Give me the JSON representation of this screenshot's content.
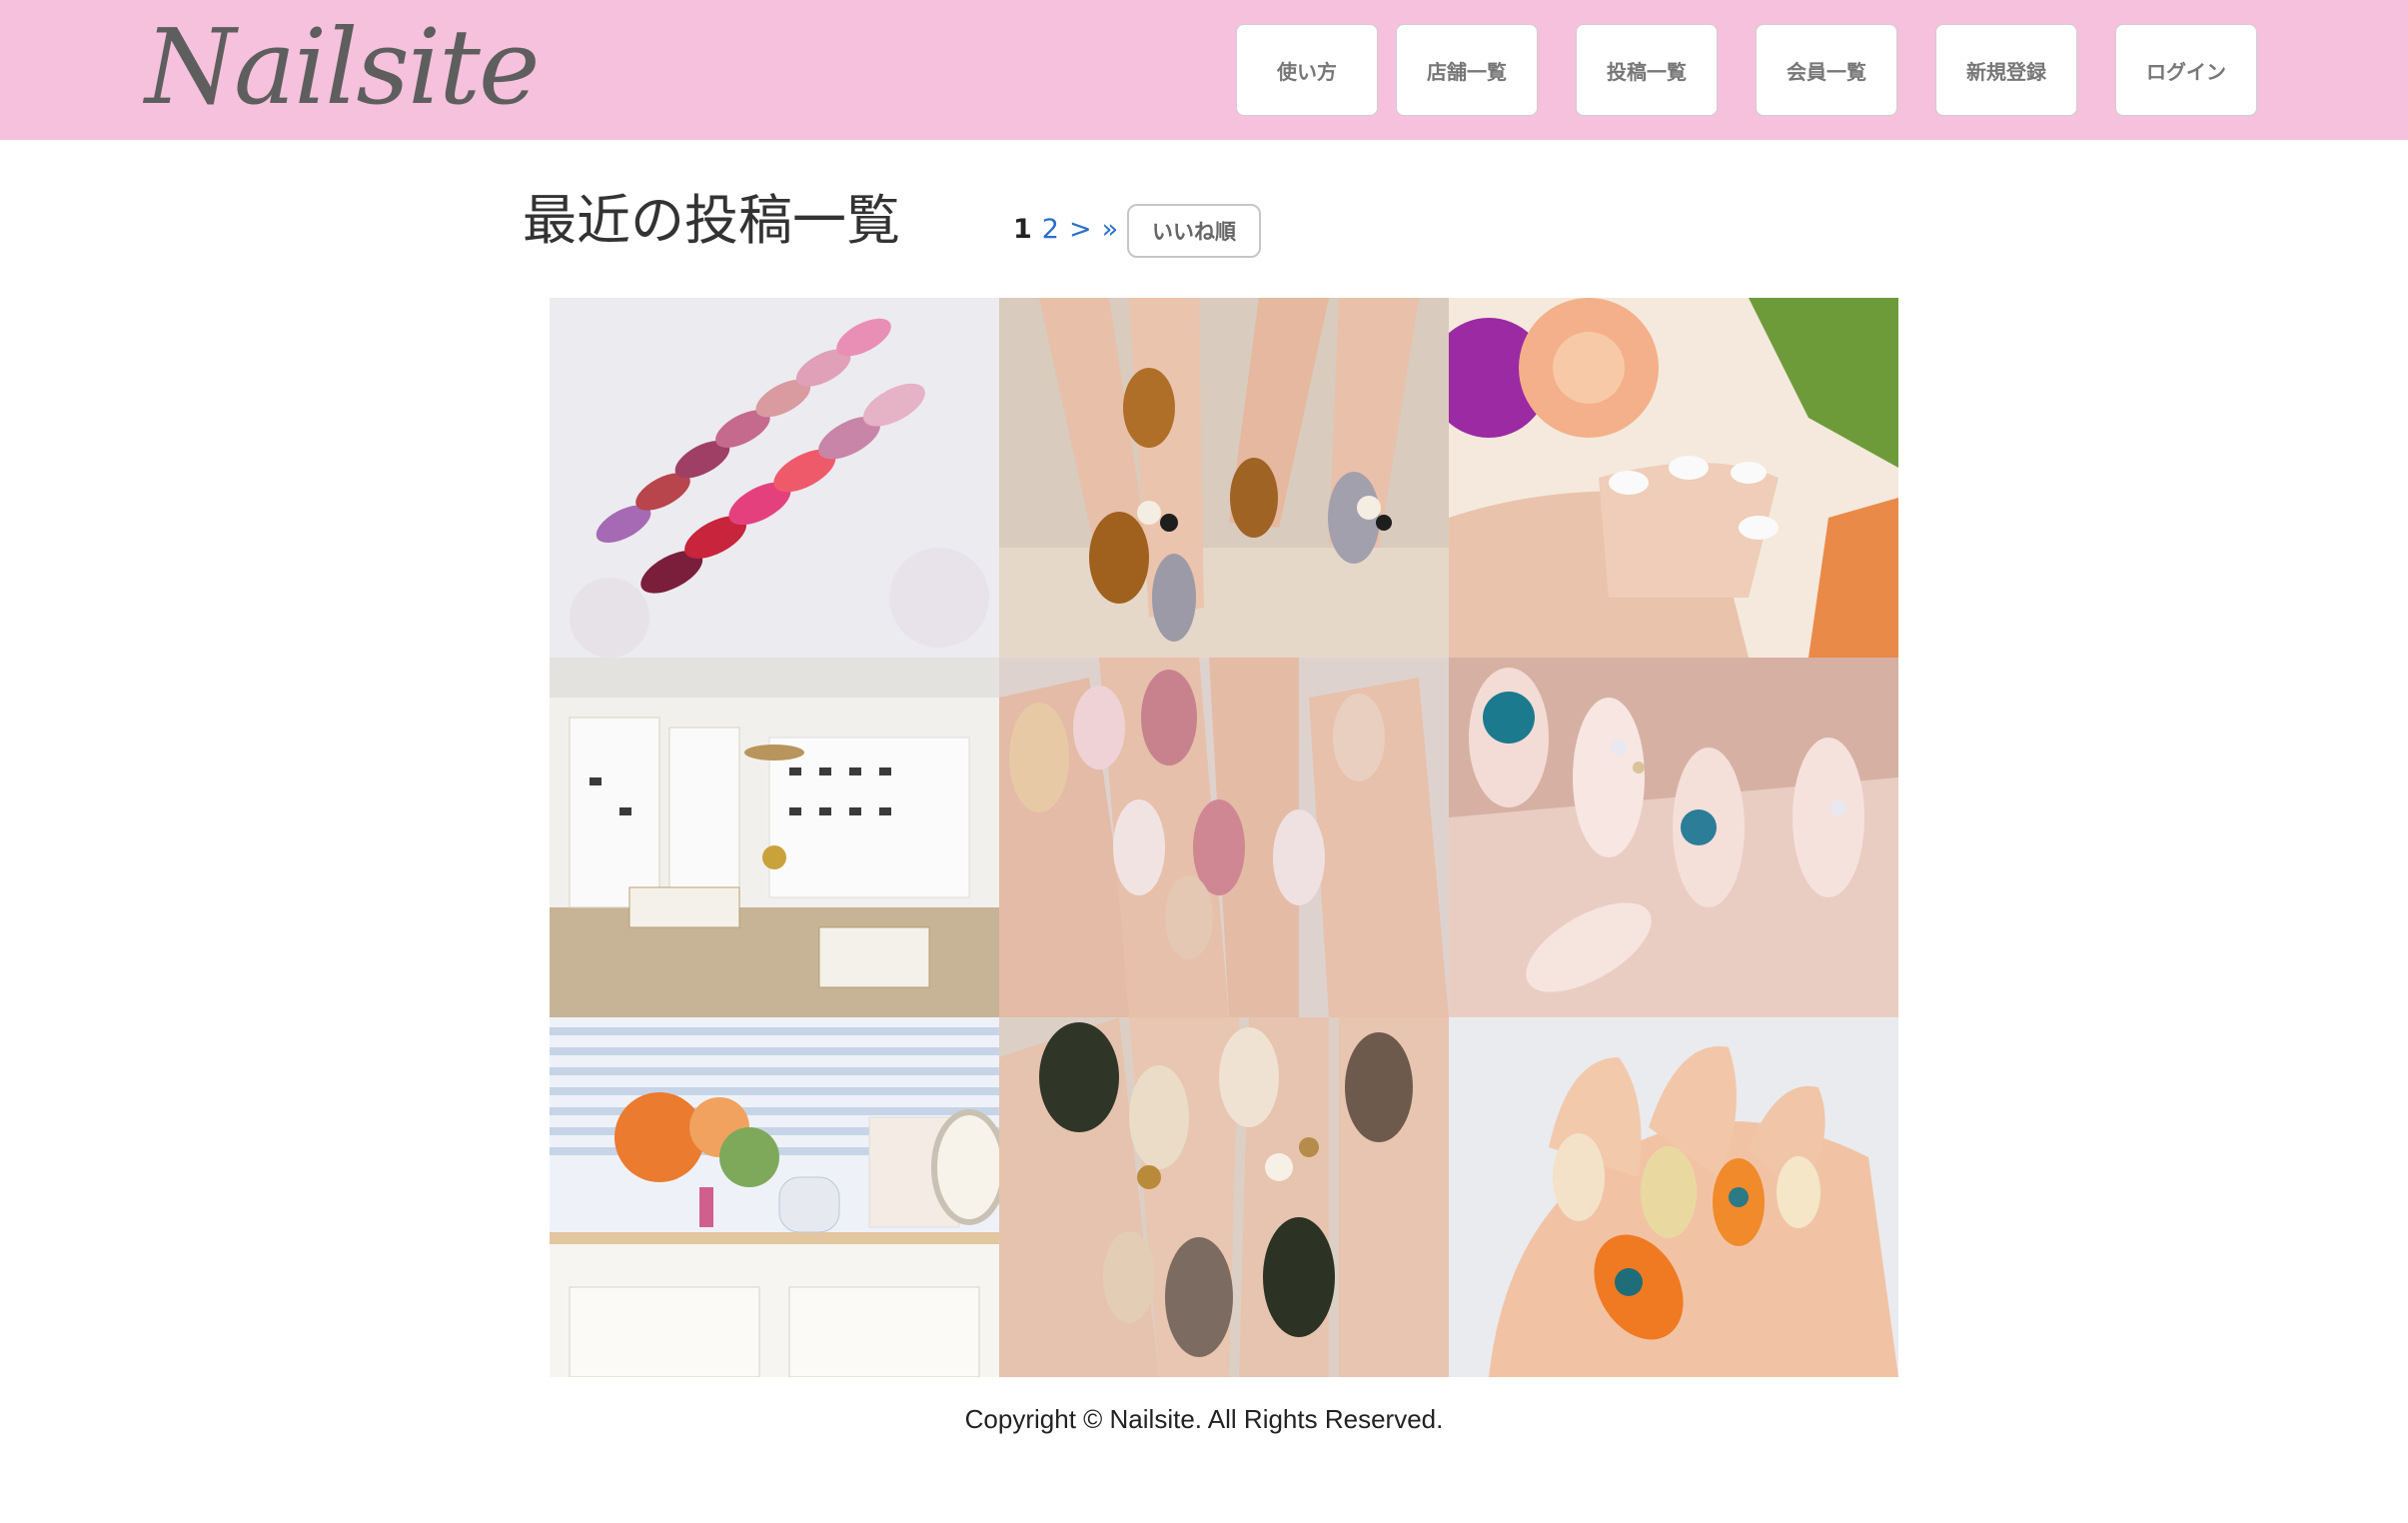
{
  "header": {
    "logo": "Nailsite",
    "nav": [
      "使い方",
      "店舗一覧",
      "投稿一覧",
      "会員一覧",
      "新規登録",
      "ログイン"
    ]
  },
  "main": {
    "title": "最近の投稿一覧",
    "pagination": {
      "current": "1",
      "next_page": "2",
      "next": ">",
      "last": "»"
    },
    "sort_button": "いいね順",
    "posts": [
      {
        "subject": "nail-color-samples"
      },
      {
        "subject": "tortoiseshell-nails-with-pearls"
      },
      {
        "subject": "french-nails-with-flowers"
      },
      {
        "subject": "salon-interior-shelves"
      },
      {
        "subject": "pink-glitter-nails"
      },
      {
        "subject": "clear-nails-with-stones"
      },
      {
        "subject": "salon-counter-with-flowers"
      },
      {
        "subject": "tweed-pattern-nails"
      },
      {
        "subject": "orange-marble-nails"
      }
    ]
  },
  "footer": {
    "copyright": "Copyright © Nailsite. All Rights Reserved."
  },
  "colors": {
    "header_bg": "#f5c1dc",
    "link": "#2a6fc9"
  }
}
